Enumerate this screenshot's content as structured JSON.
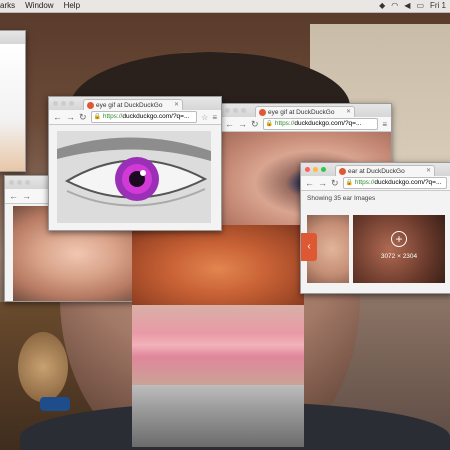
{
  "menubar": {
    "items": [
      "arks",
      "Window",
      "Help"
    ],
    "clock": "Fri 1"
  },
  "windows": {
    "eye": {
      "tab_title": "eye gif at DuckDuckGo",
      "url_https": "https://",
      "url_rest": "duckduckgo.com/?q=..."
    },
    "eye2": {
      "tab_title": "eye gif at DuckDuckGo",
      "url_https": "https://",
      "url_rest": "duckduckgo.com/?q=..."
    },
    "ears": {
      "tab_title": "ear at DuckDuckGo",
      "url_https": "https://",
      "url_rest": "duckduckgo.com/?q=...",
      "showing": "Showing 35 ear Images",
      "resolution": "3072 × 2304"
    }
  },
  "icons": {
    "back": "back-arrow-icon",
    "forward": "forward-arrow-icon",
    "reload": "reload-icon",
    "star": "bookmark-star-icon",
    "menu": "hamburger-menu-icon",
    "plus": "expand-plus-icon"
  },
  "colors": {
    "ddg_orange": "#de5833",
    "https_green": "#2e8b2e"
  }
}
